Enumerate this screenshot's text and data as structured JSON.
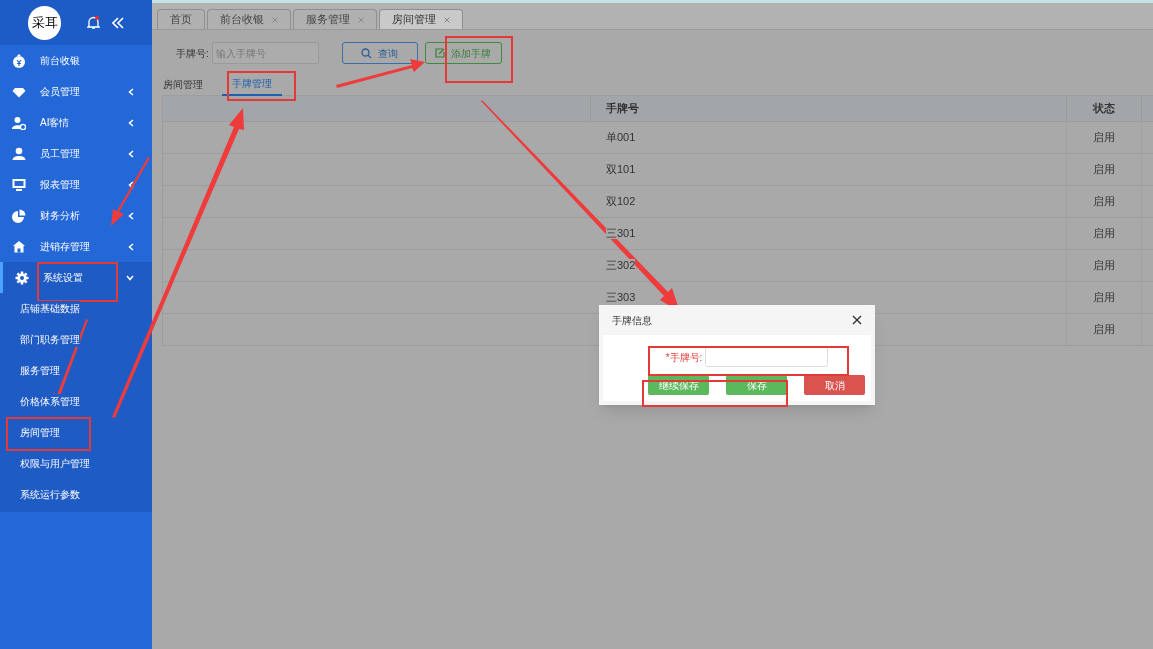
{
  "sidebar": {
    "logo": "采耳",
    "notification": true,
    "menu": [
      {
        "label": "前台收银",
        "kind": "link",
        "selected": false
      },
      {
        "label": "会员管理",
        "kind": "group",
        "expanded": false,
        "selected": false
      },
      {
        "label": "AI客情",
        "kind": "group",
        "expanded": false,
        "selected": false
      },
      {
        "label": "员工管理",
        "kind": "group",
        "expanded": false,
        "selected": false
      },
      {
        "label": "报表管理",
        "kind": "group",
        "expanded": false,
        "selected": false
      },
      {
        "label": "财务分析",
        "kind": "group",
        "expanded": false,
        "selected": false
      },
      {
        "label": "进销存管理",
        "kind": "group",
        "expanded": false,
        "selected": false
      },
      {
        "label": "系统设置",
        "kind": "group",
        "expanded": true,
        "selected": true,
        "children": [
          {
            "label": "店铺基础数据"
          },
          {
            "label": "部门职务管理"
          },
          {
            "label": "服务管理"
          },
          {
            "label": "价格体系管理"
          },
          {
            "label": "房间管理"
          },
          {
            "label": "权限与用户管理"
          },
          {
            "label": "系统运行参数"
          }
        ]
      }
    ]
  },
  "tabs": [
    {
      "label": "首页",
      "closable": false,
      "selected": false
    },
    {
      "label": "前台收银",
      "closable": true,
      "selected": false
    },
    {
      "label": "服务管理",
      "closable": true,
      "selected": false
    },
    {
      "label": "房间管理",
      "closable": true,
      "selected": true
    }
  ],
  "search": {
    "label": "手牌号:",
    "placeholder": "输入手牌号",
    "buttons": [
      {
        "label": "查询",
        "kind": "search"
      },
      {
        "label": "添加手牌",
        "kind": "add"
      }
    ]
  },
  "subtabs": [
    {
      "label": "房间管理",
      "selected": false
    },
    {
      "label": "手牌管理",
      "selected": true
    }
  ],
  "table": {
    "columns": [
      "手牌号",
      "状态"
    ],
    "rows": [
      {
        "number": "单001",
        "status": "启用"
      },
      {
        "number": "双101",
        "status": "启用"
      },
      {
        "number": "双102",
        "status": "启用"
      },
      {
        "number": "三301",
        "status": "启用"
      },
      {
        "number": "三302",
        "status": "启用"
      },
      {
        "number": "三303",
        "status": "启用"
      },
      {
        "status": "启用"
      }
    ]
  },
  "dialog": {
    "title": "手牌信息",
    "field_label": "*手牌号:",
    "buttons": [
      {
        "label": "继续保存",
        "kind": "ok"
      },
      {
        "label": "保存",
        "kind": "ok"
      },
      {
        "label": "取消",
        "kind": "cancel"
      }
    ]
  }
}
